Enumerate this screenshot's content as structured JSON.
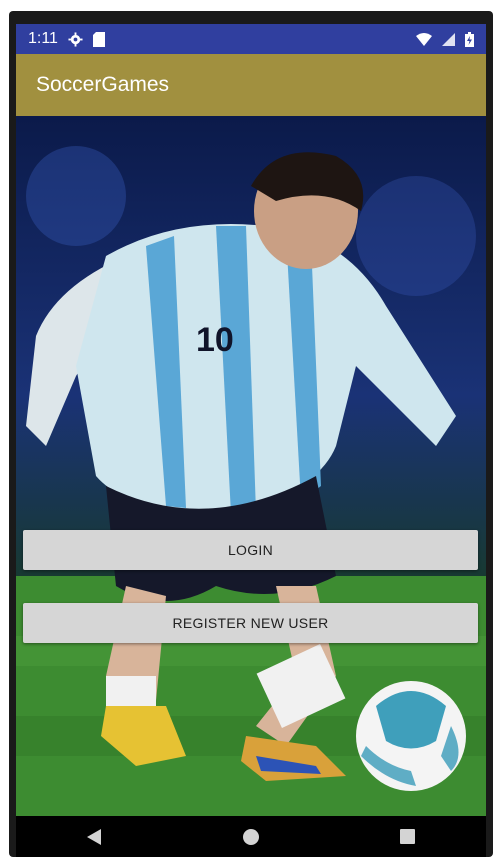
{
  "status_bar": {
    "time": "1:11",
    "icons": [
      "settings-icon",
      "sd-card-icon",
      "wifi-icon",
      "signal-icon",
      "battery-icon"
    ]
  },
  "app_bar": {
    "title": "SoccerGames"
  },
  "main": {
    "background_image": "soccer player in striped jersey number 10 dribbling a ball on grass",
    "jersey_number": "10",
    "login_label": "LOGIN",
    "register_label": "REGISTER NEW USER"
  },
  "nav_bar": {
    "items": [
      "back-icon",
      "home-icon",
      "recents-icon"
    ]
  },
  "colors": {
    "status_bar": "#303f9f",
    "app_bar": "#a1903f",
    "button_bg": "#d6d6d6",
    "nav_bar": "#000000"
  }
}
